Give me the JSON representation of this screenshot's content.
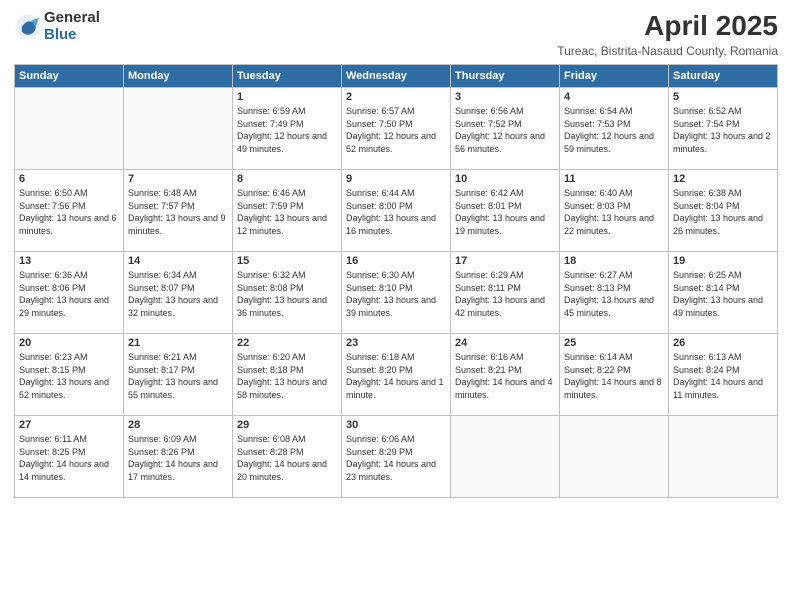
{
  "logo": {
    "general": "General",
    "blue": "Blue"
  },
  "title": "April 2025",
  "subtitle": "Tureac, Bistrita-Nasaud County, Romania",
  "headers": [
    "Sunday",
    "Monday",
    "Tuesday",
    "Wednesday",
    "Thursday",
    "Friday",
    "Saturday"
  ],
  "weeks": [
    [
      {
        "day": "",
        "info": ""
      },
      {
        "day": "",
        "info": ""
      },
      {
        "day": "1",
        "info": "Sunrise: 6:59 AM\nSunset: 7:49 PM\nDaylight: 12 hours and 49 minutes."
      },
      {
        "day": "2",
        "info": "Sunrise: 6:57 AM\nSunset: 7:50 PM\nDaylight: 12 hours and 52 minutes."
      },
      {
        "day": "3",
        "info": "Sunrise: 6:56 AM\nSunset: 7:52 PM\nDaylight: 12 hours and 56 minutes."
      },
      {
        "day": "4",
        "info": "Sunrise: 6:54 AM\nSunset: 7:53 PM\nDaylight: 12 hours and 59 minutes."
      },
      {
        "day": "5",
        "info": "Sunrise: 6:52 AM\nSunset: 7:54 PM\nDaylight: 13 hours and 2 minutes."
      }
    ],
    [
      {
        "day": "6",
        "info": "Sunrise: 6:50 AM\nSunset: 7:56 PM\nDaylight: 13 hours and 6 minutes."
      },
      {
        "day": "7",
        "info": "Sunrise: 6:48 AM\nSunset: 7:57 PM\nDaylight: 13 hours and 9 minutes."
      },
      {
        "day": "8",
        "info": "Sunrise: 6:46 AM\nSunset: 7:59 PM\nDaylight: 13 hours and 12 minutes."
      },
      {
        "day": "9",
        "info": "Sunrise: 6:44 AM\nSunset: 8:00 PM\nDaylight: 13 hours and 16 minutes."
      },
      {
        "day": "10",
        "info": "Sunrise: 6:42 AM\nSunset: 8:01 PM\nDaylight: 13 hours and 19 minutes."
      },
      {
        "day": "11",
        "info": "Sunrise: 6:40 AM\nSunset: 8:03 PM\nDaylight: 13 hours and 22 minutes."
      },
      {
        "day": "12",
        "info": "Sunrise: 6:38 AM\nSunset: 8:04 PM\nDaylight: 13 hours and 26 minutes."
      }
    ],
    [
      {
        "day": "13",
        "info": "Sunrise: 6:36 AM\nSunset: 8:06 PM\nDaylight: 13 hours and 29 minutes."
      },
      {
        "day": "14",
        "info": "Sunrise: 6:34 AM\nSunset: 8:07 PM\nDaylight: 13 hours and 32 minutes."
      },
      {
        "day": "15",
        "info": "Sunrise: 6:32 AM\nSunset: 8:08 PM\nDaylight: 13 hours and 36 minutes."
      },
      {
        "day": "16",
        "info": "Sunrise: 6:30 AM\nSunset: 8:10 PM\nDaylight: 13 hours and 39 minutes."
      },
      {
        "day": "17",
        "info": "Sunrise: 6:29 AM\nSunset: 8:11 PM\nDaylight: 13 hours and 42 minutes."
      },
      {
        "day": "18",
        "info": "Sunrise: 6:27 AM\nSunset: 8:13 PM\nDaylight: 13 hours and 45 minutes."
      },
      {
        "day": "19",
        "info": "Sunrise: 6:25 AM\nSunset: 8:14 PM\nDaylight: 13 hours and 49 minutes."
      }
    ],
    [
      {
        "day": "20",
        "info": "Sunrise: 6:23 AM\nSunset: 8:15 PM\nDaylight: 13 hours and 52 minutes."
      },
      {
        "day": "21",
        "info": "Sunrise: 6:21 AM\nSunset: 8:17 PM\nDaylight: 13 hours and 55 minutes."
      },
      {
        "day": "22",
        "info": "Sunrise: 6:20 AM\nSunset: 8:18 PM\nDaylight: 13 hours and 58 minutes."
      },
      {
        "day": "23",
        "info": "Sunrise: 6:18 AM\nSunset: 8:20 PM\nDaylight: 14 hours and 1 minute."
      },
      {
        "day": "24",
        "info": "Sunrise: 6:16 AM\nSunset: 8:21 PM\nDaylight: 14 hours and 4 minutes."
      },
      {
        "day": "25",
        "info": "Sunrise: 6:14 AM\nSunset: 8:22 PM\nDaylight: 14 hours and 8 minutes."
      },
      {
        "day": "26",
        "info": "Sunrise: 6:13 AM\nSunset: 8:24 PM\nDaylight: 14 hours and 11 minutes."
      }
    ],
    [
      {
        "day": "27",
        "info": "Sunrise: 6:11 AM\nSunset: 8:25 PM\nDaylight: 14 hours and 14 minutes."
      },
      {
        "day": "28",
        "info": "Sunrise: 6:09 AM\nSunset: 8:26 PM\nDaylight: 14 hours and 17 minutes."
      },
      {
        "day": "29",
        "info": "Sunrise: 6:08 AM\nSunset: 8:28 PM\nDaylight: 14 hours and 20 minutes."
      },
      {
        "day": "30",
        "info": "Sunrise: 6:06 AM\nSunset: 8:29 PM\nDaylight: 14 hours and 23 minutes."
      },
      {
        "day": "",
        "info": ""
      },
      {
        "day": "",
        "info": ""
      },
      {
        "day": "",
        "info": ""
      }
    ]
  ]
}
